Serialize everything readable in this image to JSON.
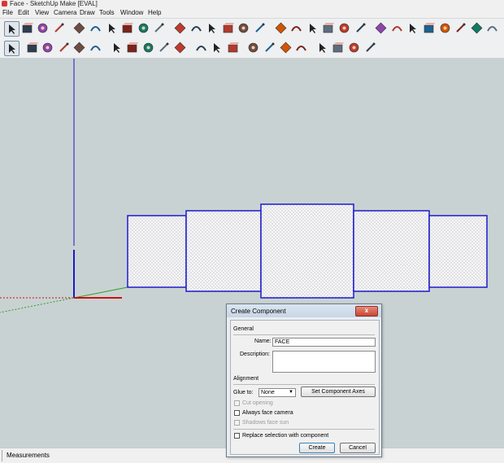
{
  "window": {
    "title": "Face - SketchUp Make [EVAL]"
  },
  "menu": {
    "items": [
      "File",
      "Edit",
      "View",
      "Camera",
      "Draw",
      "Tools",
      "Window",
      "Help"
    ]
  },
  "toolbar_top": {
    "icons": [
      "select-icon",
      "make-component-icon",
      "paint-bucket-icon",
      "eraser-icon",
      "rectangle-icon",
      "line-icon",
      "circle-icon",
      "arc-icon",
      "polygon-icon",
      "freehand-icon",
      "move-icon",
      "push-pull-icon",
      "rotate-icon",
      "follow-me-icon",
      "scale-icon",
      "offset-icon",
      "tape-measure-icon",
      "dimension-icon",
      "protractor-icon",
      "text-icon",
      "axes-icon",
      "3d-text-icon",
      "orbit-icon",
      "pan-icon",
      "zoom-icon",
      "zoom-window-icon",
      "zoom-extents-icon",
      "previous-view-icon",
      "position-camera-icon",
      "look-around-icon"
    ]
  },
  "toolbar_bottom": {
    "icons": [
      "select-icon",
      "eraser-icon",
      "line-icon",
      "rectangle-icon",
      "circle-icon",
      "arc-icon",
      "push-pull-icon",
      "follow-me-icon",
      "move-icon",
      "rotate-icon",
      "scale-icon",
      "tape-measure-icon",
      "text-icon",
      "paint-bucket-icon",
      "orbit-icon",
      "pan-icon",
      "zoom-icon",
      "zoom-extents-icon",
      "3d-warehouse-icon",
      "get-models-icon",
      "share-model-icon",
      "extension-warehouse-icon"
    ]
  },
  "colors": {
    "face_outline": "#1a1acc",
    "axis_red": "#cc1010",
    "axis_green": "#2aa02a",
    "axis_blue": "#1a1acc"
  },
  "status": {
    "measurements_label": "Measurements"
  },
  "dialog": {
    "title": "Create Component",
    "close_label": "x",
    "general_label": "General",
    "name_label": "Name:",
    "name_value": "FACE",
    "description_label": "Description:",
    "description_value": "",
    "alignment_label": "Alignment",
    "glue_label": "Glue to:",
    "glue_value": "None",
    "set_axes_label": "Set Component Axes",
    "cut_opening_label": "Cut opening",
    "always_face_camera_label": "Always face camera",
    "shadows_face_sun_label": "Shadows face sun",
    "replace_selection_label": "Replace selection with component",
    "create_label": "Create",
    "cancel_label": "Cancel",
    "cut_opening_checked": false,
    "always_face_camera_checked": false,
    "shadows_face_sun_checked": false,
    "replace_selection_checked": false
  }
}
